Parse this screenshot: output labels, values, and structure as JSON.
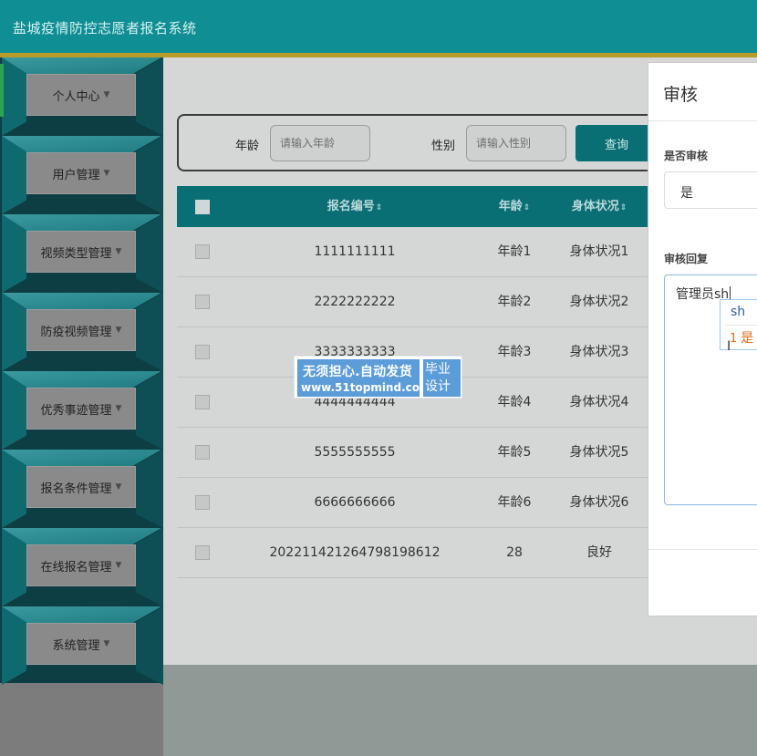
{
  "header": {
    "title": "盐城疫情防控志愿者报名系统"
  },
  "sidebar": {
    "items": [
      {
        "label": "个人中心",
        "name": "sidebar-item-personal-center"
      },
      {
        "label": "用户管理",
        "name": "sidebar-item-user-management"
      },
      {
        "label": "视频类型管理",
        "name": "sidebar-item-video-type-management"
      },
      {
        "label": "防疫视频管理",
        "name": "sidebar-item-epidemic-video-management"
      },
      {
        "label": "优秀事迹管理",
        "name": "sidebar-item-excellent-deeds-management"
      },
      {
        "label": "报名条件管理",
        "name": "sidebar-item-registration-condition-management"
      },
      {
        "label": "在线报名管理",
        "name": "sidebar-item-online-registration-management"
      },
      {
        "label": "系统管理",
        "name": "sidebar-item-system-management"
      }
    ],
    "caret": "▼"
  },
  "search": {
    "age_label": "年龄",
    "age_placeholder": "请输入年龄",
    "gender_label": "性别",
    "gender_placeholder": "请输入性别",
    "query_button": "查询"
  },
  "table": {
    "columns": [
      "报名编号",
      "年龄",
      "身体状况"
    ],
    "sort_icon": "⇕",
    "rows": [
      {
        "id": "1111111111",
        "age": "年龄1",
        "health": "身体状况1"
      },
      {
        "id": "2222222222",
        "age": "年龄2",
        "health": "身体状况2"
      },
      {
        "id": "3333333333",
        "age": "年龄3",
        "health": "身体状况3"
      },
      {
        "id": "4444444444",
        "age": "年龄4",
        "health": "身体状况4"
      },
      {
        "id": "5555555555",
        "age": "年龄5",
        "health": "身体状况5"
      },
      {
        "id": "6666666666",
        "age": "年龄6",
        "health": "身体状况6"
      },
      {
        "id": "20221142126479819861​2",
        "age": "28",
        "health": "良好"
      }
    ]
  },
  "dialog": {
    "title": "审核",
    "review_label": "是否审核",
    "review_value": "是",
    "reply_label": "审核回复",
    "reply_value": "管理员sh"
  },
  "ime": {
    "composition": "sh",
    "candidate_number": "1",
    "candidate": "是"
  },
  "watermark": {
    "line1": "无须担心.自动发货",
    "line2": "www.51topmind.com",
    "right1": "毕业",
    "right2": "设计"
  }
}
